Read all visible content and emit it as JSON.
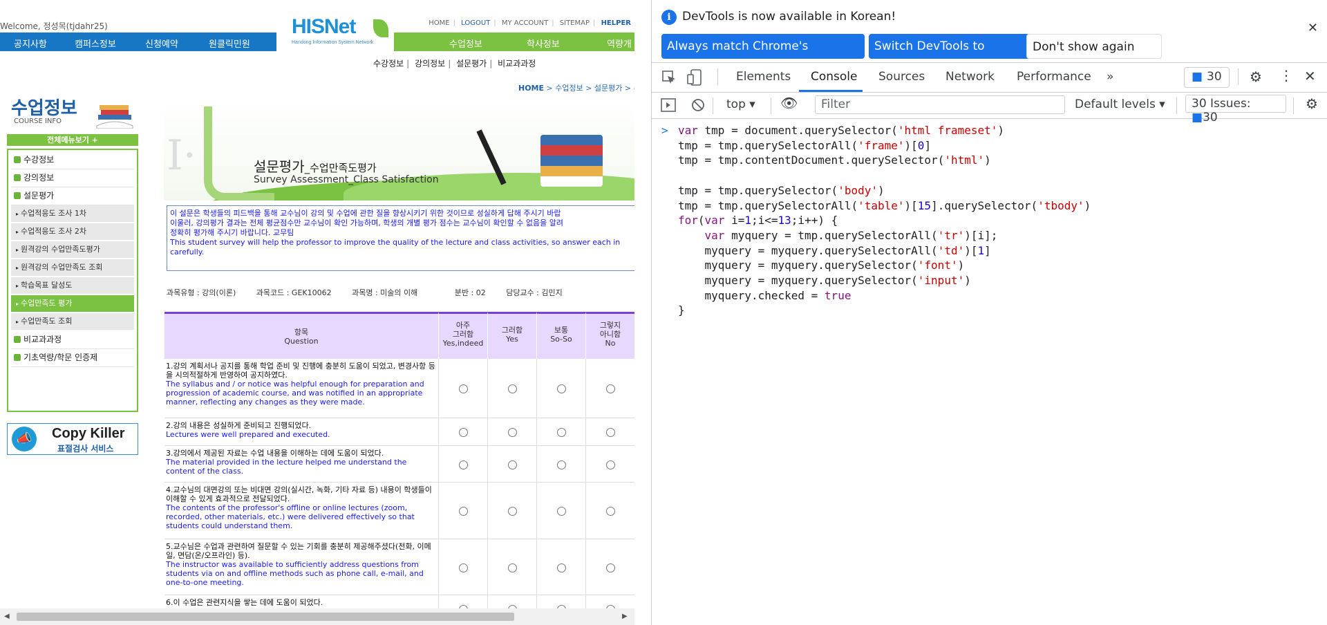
{
  "site": {
    "welcome": "Welcome, 정성목(tjdahr25)",
    "logo_text": "HISNet",
    "logo_sub": "Handong Information System Network",
    "top_links": [
      "HOME",
      "LOGOUT",
      "MY ACCOUNT",
      "SITEMAP",
      "HELPER"
    ],
    "nav_left": [
      "공지사항",
      "캠퍼스정보",
      "신청예약",
      "원클릭민원"
    ],
    "nav_right": [
      "수업정보",
      "학사정보",
      "역량개"
    ],
    "subnav": [
      "수강정보",
      "강의정보",
      "설문평가",
      "비교과과정"
    ],
    "breadcrumb_home": "HOME",
    "breadcrumb_rest": " > 수업정보 > 설문평가 > 수"
  },
  "sidebar": {
    "title": "수업정보",
    "subtitle": "COURSE INFO",
    "menu_all": "전체메뉴보기 +",
    "items": [
      {
        "label": "수강정보",
        "type": "main"
      },
      {
        "label": "강의정보",
        "type": "main"
      },
      {
        "label": "설문평가",
        "type": "main"
      },
      {
        "label": "수업적응도 조사 1차",
        "type": "sub"
      },
      {
        "label": "수업적응도 조사 2차",
        "type": "sub"
      },
      {
        "label": "원격강의 수업만족도평가",
        "type": "sub"
      },
      {
        "label": "원격강의 수업만족도 조회",
        "type": "sub"
      },
      {
        "label": "학습목표 달성도",
        "type": "sub"
      },
      {
        "label": "수업만족도 평가",
        "type": "sub-active"
      },
      {
        "label": "수업만족도 조회",
        "type": "sub"
      },
      {
        "label": "비교과과정",
        "type": "main"
      },
      {
        "label": "기초역량/학문 인증제",
        "type": "main"
      }
    ],
    "copykiller_title": "Copy Killer",
    "copykiller_sub": "표절검사 서비스"
  },
  "banner": {
    "title": "설문평가",
    "title_suffix": "_수업만족도평가",
    "title_en": "Survey Assessment_Class Satisfaction"
  },
  "notice": {
    "ko1": "이 설문은 학생들의 피드백을 통해 교수님이 강의 및 수업에 관한 질을 향상시키기 위한 것이므로 성실하게 답해 주시기 바랍",
    "ko2": "이울러, 강의평가 결과는 전체 평균점수만 교수님이 확인 가능하며, 학생의 개별 평가 점수는 교수님이 확인할 수 없음을 알려",
    "ko3": "정확히 평가해 주시기 바랍니다. 교무팀",
    "en1": "This student survey will help the professor to improve the quality of the lecture and class activities, so answer each in",
    "en2": "carefully."
  },
  "course": {
    "type": "과목유형 : 강의(이론)",
    "code": "과목코드 : GEK10062",
    "name": "과목명 : 미술의 이해",
    "section": "분반 : 02",
    "professor": "담당교수 : 김민지"
  },
  "survey": {
    "header_item_ko": "항목",
    "header_item_en": "Question",
    "columns": [
      {
        "ko1": "아주",
        "ko2": "그러함",
        "en": "Yes,indeed"
      },
      {
        "ko1": "",
        "ko2": "그러함",
        "en": "Yes"
      },
      {
        "ko1": "",
        "ko2": "보통",
        "en": "So-So"
      },
      {
        "ko1": "그렇지",
        "ko2": "아니함",
        "en": "No"
      }
    ],
    "questions": [
      {
        "ko": "1.강의 계획서나 공지를 통해 학업 준비 및 진행에 충분히 도움이 되었고, 변경사항 등을 시의적절하게 반영하여 공지하였다.",
        "en": "The syllabus and / or notice was helpful enough for preparation and progression of academic course, and was notified in an appropriate manner, reflecting any changes as they were made."
      },
      {
        "ko": "2.강의 내용은 성실하게 준비되고 진행되었다.",
        "en": "Lectures were well prepared and executed."
      },
      {
        "ko": "3.강의에서 제공된 자료는 수업 내용을 이해하는 데에 도움이 되었다.",
        "en": "The material provided in the lecture helped me understand the content of the class."
      },
      {
        "ko": "4.교수님의 대면강의 또는 비대면 강의(실시간, 녹화, 기타 자료 등) 내용이 학생들이 이해할 수 있게 효과적으로 전달되었다.",
        "en": "The contents of the professor's offline or online lectures (zoom, recorded, other materials, etc.) were delivered effectively so that students could understand them."
      },
      {
        "ko": "5.교수님은 수업과 관련하여 질문할 수 있는 기회를 충분히 제공해주셨다(전화, 이메일, 면담(온/오프라인) 등).",
        "en": "The instructor was available to sufficiently address questions from students via on and offline methods such as phone call, e-mail, and one-to-one meeting."
      },
      {
        "ko": "6.이 수업은 관련지식을 쌓는 데에 도움이 되었다.",
        "en": ""
      }
    ]
  },
  "devtools": {
    "banner_message": "DevTools is now available in Korean!",
    "btn_match": "Always match Chrome's language",
    "btn_switch": "Switch DevTools to Korean",
    "btn_dont": "Don't show again",
    "tabs": [
      "Elements",
      "Console",
      "Sources",
      "Network",
      "Performance"
    ],
    "active_tab": "Console",
    "issues_count": "30",
    "context": "top",
    "filter_placeholder": "Filter",
    "levels": "Default levels",
    "issues_label": "30 Issues:",
    "issues_count2": "30",
    "prompt": ">",
    "code_lines": [
      "var tmp = document.querySelector('html frameset')",
      "tmp = tmp.querySelectorAll('frame')[0]",
      "tmp = tmp.contentDocument.querySelector('html')",
      "",
      "tmp = tmp.querySelector('body')",
      "tmp = tmp.querySelectorAll('table')[15].querySelector('tbody')",
      "for(var i=1;i<=13;i++) {",
      "    var myquery = tmp.querySelectorAll('tr')[i];",
      "    myquery = myquery.querySelectorAll('td')[1]",
      "    myquery = myquery.querySelector('font')",
      "    myquery = myquery.querySelector('input')",
      "    myquery.checked = true",
      "}"
    ]
  },
  "colors": {
    "nav_blue": "#1777c5",
    "nav_green": "#7cc242",
    "devtools_accent": "#1a73e8",
    "table_header": "#e7d8ff"
  }
}
